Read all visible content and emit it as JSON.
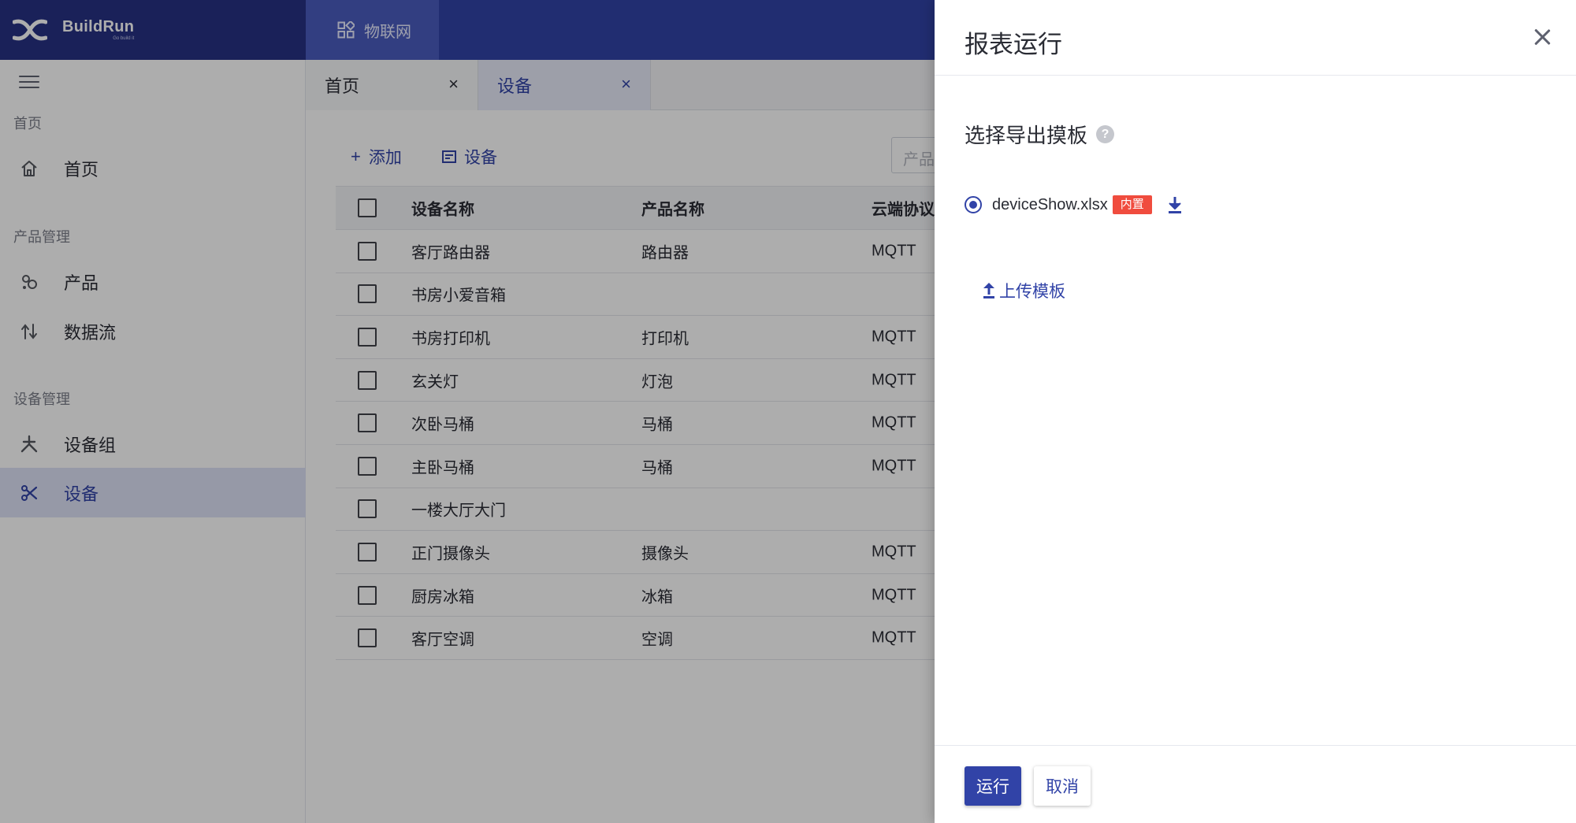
{
  "brand": {
    "name": "BuildRun",
    "sub": "Go build it"
  },
  "module_tab": {
    "label": "物联网",
    "icon": "apps-icon"
  },
  "sidebar": {
    "groups": [
      {
        "label": "首页",
        "items": [
          {
            "label": "首页",
            "icon": "home-icon"
          }
        ]
      },
      {
        "label": "产品管理",
        "items": [
          {
            "label": "产品",
            "icon": "product-icon"
          },
          {
            "label": "数据流",
            "icon": "dataflow-icon"
          }
        ]
      },
      {
        "label": "设备管理",
        "items": [
          {
            "label": "设备组",
            "icon": "device-group-icon"
          },
          {
            "label": "设备",
            "icon": "device-icon",
            "active": true
          }
        ]
      }
    ]
  },
  "page_tabs": [
    {
      "label": "首页",
      "close": "×"
    },
    {
      "label": "设备",
      "close": "×",
      "active": true
    }
  ],
  "toolbar": {
    "add_label": "添加",
    "device_label": "设备",
    "search_placeholder": "产品"
  },
  "table": {
    "headers": [
      "设备名称",
      "产品名称",
      "云端协议"
    ],
    "rows": [
      {
        "name": "客厅路由器",
        "product": "路由器",
        "protocol": "MQTT"
      },
      {
        "name": "书房小爱音箱",
        "product": "",
        "protocol": ""
      },
      {
        "name": "书房打印机",
        "product": "打印机",
        "protocol": "MQTT"
      },
      {
        "name": "玄关灯",
        "product": "灯泡",
        "protocol": "MQTT"
      },
      {
        "name": "次卧马桶",
        "product": "马桶",
        "protocol": "MQTT"
      },
      {
        "name": "主卧马桶",
        "product": "马桶",
        "protocol": "MQTT"
      },
      {
        "name": "一楼大厅大门",
        "product": "",
        "protocol": ""
      },
      {
        "name": "正门摄像头",
        "product": "摄像头",
        "protocol": "MQTT"
      },
      {
        "name": "厨房冰箱",
        "product": "冰箱",
        "protocol": "MQTT"
      },
      {
        "name": "客厅空调",
        "product": "空调",
        "protocol": "MQTT"
      }
    ]
  },
  "drawer": {
    "title": "报表运行",
    "section_title": "选择导出摸板",
    "help": "?",
    "template": {
      "name": "deviceShow.xlsx",
      "badge": "内置",
      "selected": true
    },
    "upload_label": "上传模板",
    "run_label": "运行",
    "cancel_label": "取消"
  },
  "colors": {
    "primary": "#3143a7",
    "header_dark": "#273284",
    "badge": "#f04c3e"
  }
}
